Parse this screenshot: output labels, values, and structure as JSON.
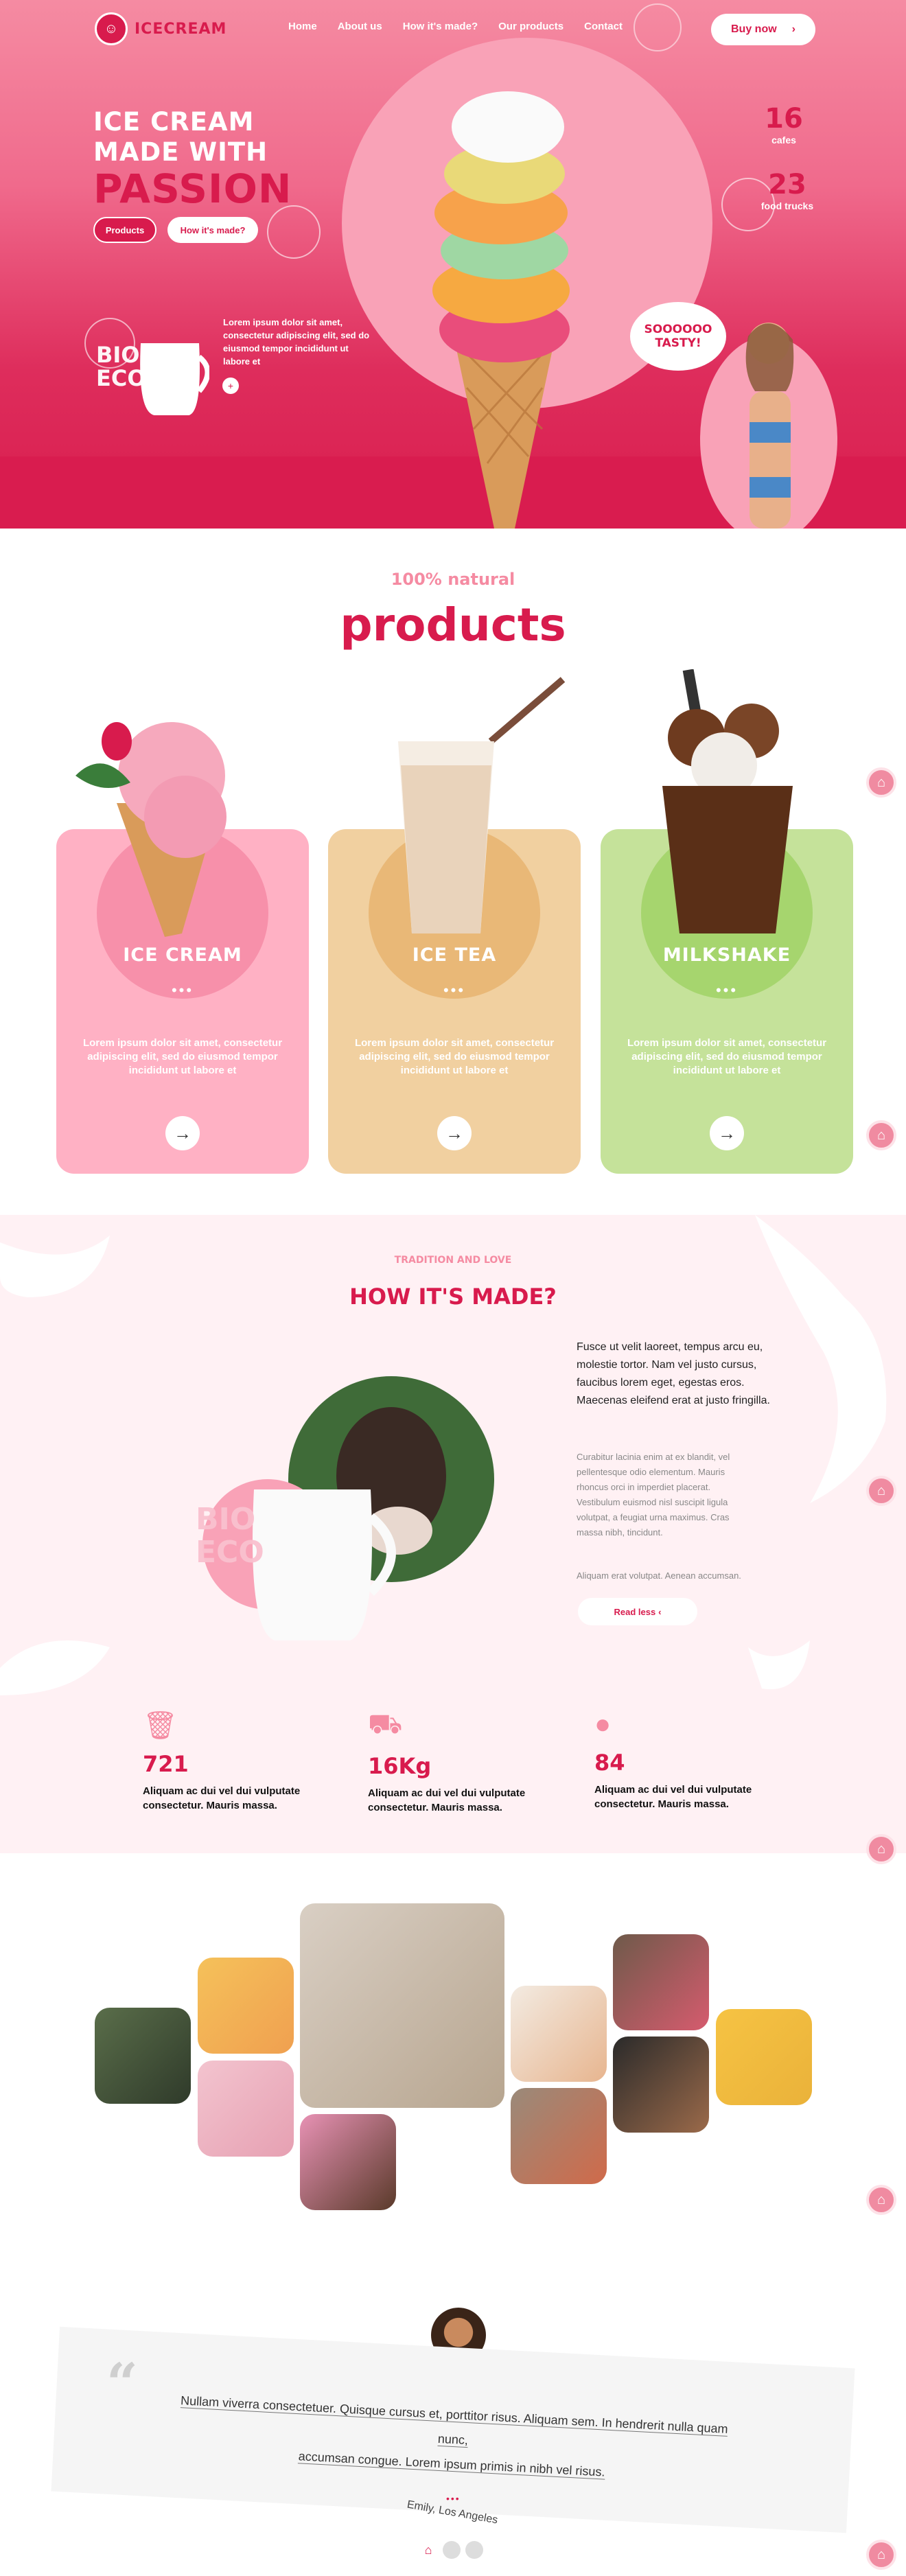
{
  "brand": {
    "name": "ICECREAM"
  },
  "nav": {
    "items": [
      "Home",
      "About us",
      "How it's made?",
      "Our products",
      "Contact"
    ],
    "buy_label": "Buy now"
  },
  "hero": {
    "headline_1": "ICE CREAM",
    "headline_2": "MADE WITH",
    "headline_3": "PASSION",
    "btn_products": "Products",
    "btn_how": "How it's made?",
    "stat1_num": "16",
    "stat1_label": "cafes",
    "stat2_num": "23",
    "stat2_label": "food trucks",
    "text": "Lorem ipsum dolor sit amet, consectetur adipiscing elit, sed do eiusmod tempor incididunt ut labore et",
    "bubble": "SOOOOOO TASTY!",
    "eco_1": "BIO",
    "eco_2": "ECO"
  },
  "products": {
    "kicker": "100% natural",
    "title": "products",
    "cards": [
      {
        "title": "ICE CREAM",
        "dots": "•••",
        "text": "Lorem ipsum dolor sit amet, consectetur adipiscing elit, sed do eiusmod tempor incididunt ut labore et",
        "color": "#ffb1c4",
        "circle": "#f790aa"
      },
      {
        "title": "ICE TEA",
        "dots": "•••",
        "text": "Lorem ipsum dolor sit amet, consectetur adipiscing elit, sed do eiusmod tempor incididunt ut labore et",
        "color": "#f1d0a0",
        "circle": "#e9b877"
      },
      {
        "title": "MILKSHAKE",
        "dots": "•••",
        "text": "Lorem ipsum dolor sit amet, consectetur adipiscing elit, sed do eiusmod tempor incididunt ut labore et",
        "color": "#c5e29a",
        "circle": "#a6d56e"
      }
    ]
  },
  "how": {
    "kicker": "TRADITION AND LOVE",
    "title": "HOW IT'S MADE?",
    "p1": "Fusce ut velit laoreet, tempus arcu eu, molestie tortor. Nam vel justo cursus, faucibus lorem eget, egestas eros. Maecenas eleifend erat at justo fringilla.",
    "p2": "Curabitur lacinia enim at ex blandit, vel pellentesque odio elementum. Mauris rhoncus orci in imperdiet placerat. Vestibulum euismod nisl suscipit ligula volutpat, a feugiat urna maximus. Cras massa nibh, tincidunt.",
    "p3": "Aliquam erat volutpat. Aenean accumsan.",
    "read_less": "Read less",
    "eco_1": "BIO",
    "eco_2": "ECO"
  },
  "stats": [
    {
      "num": "721",
      "text": "Aliquam ac dui vel dui vulputate consectetur. Mauris massa.",
      "icon": "cup-icon"
    },
    {
      "num": "16Kg",
      "text": "Aliquam ac dui vel dui vulputate consectetur. Mauris massa.",
      "icon": "truck-icon"
    },
    {
      "num": "84",
      "text": "Aliquam ac dui vel dui vulputate consectetur. Mauris massa.",
      "icon": "drop-icon"
    }
  ],
  "testimonial": {
    "text_1": "Nullam viverra consectetuer. Quisque cursus et, porttitor risus. Aliquam sem. In hendrerit nulla quam nunc,",
    "text_2": "accumsan congue. Lorem ipsum primis in nibh vel risus.",
    "dots": "•••",
    "name": "Emily, Los Angeles"
  },
  "colors": {
    "primary": "#d81b4d",
    "pink": "#f58ba2",
    "light_pink": "#fff1f4"
  }
}
